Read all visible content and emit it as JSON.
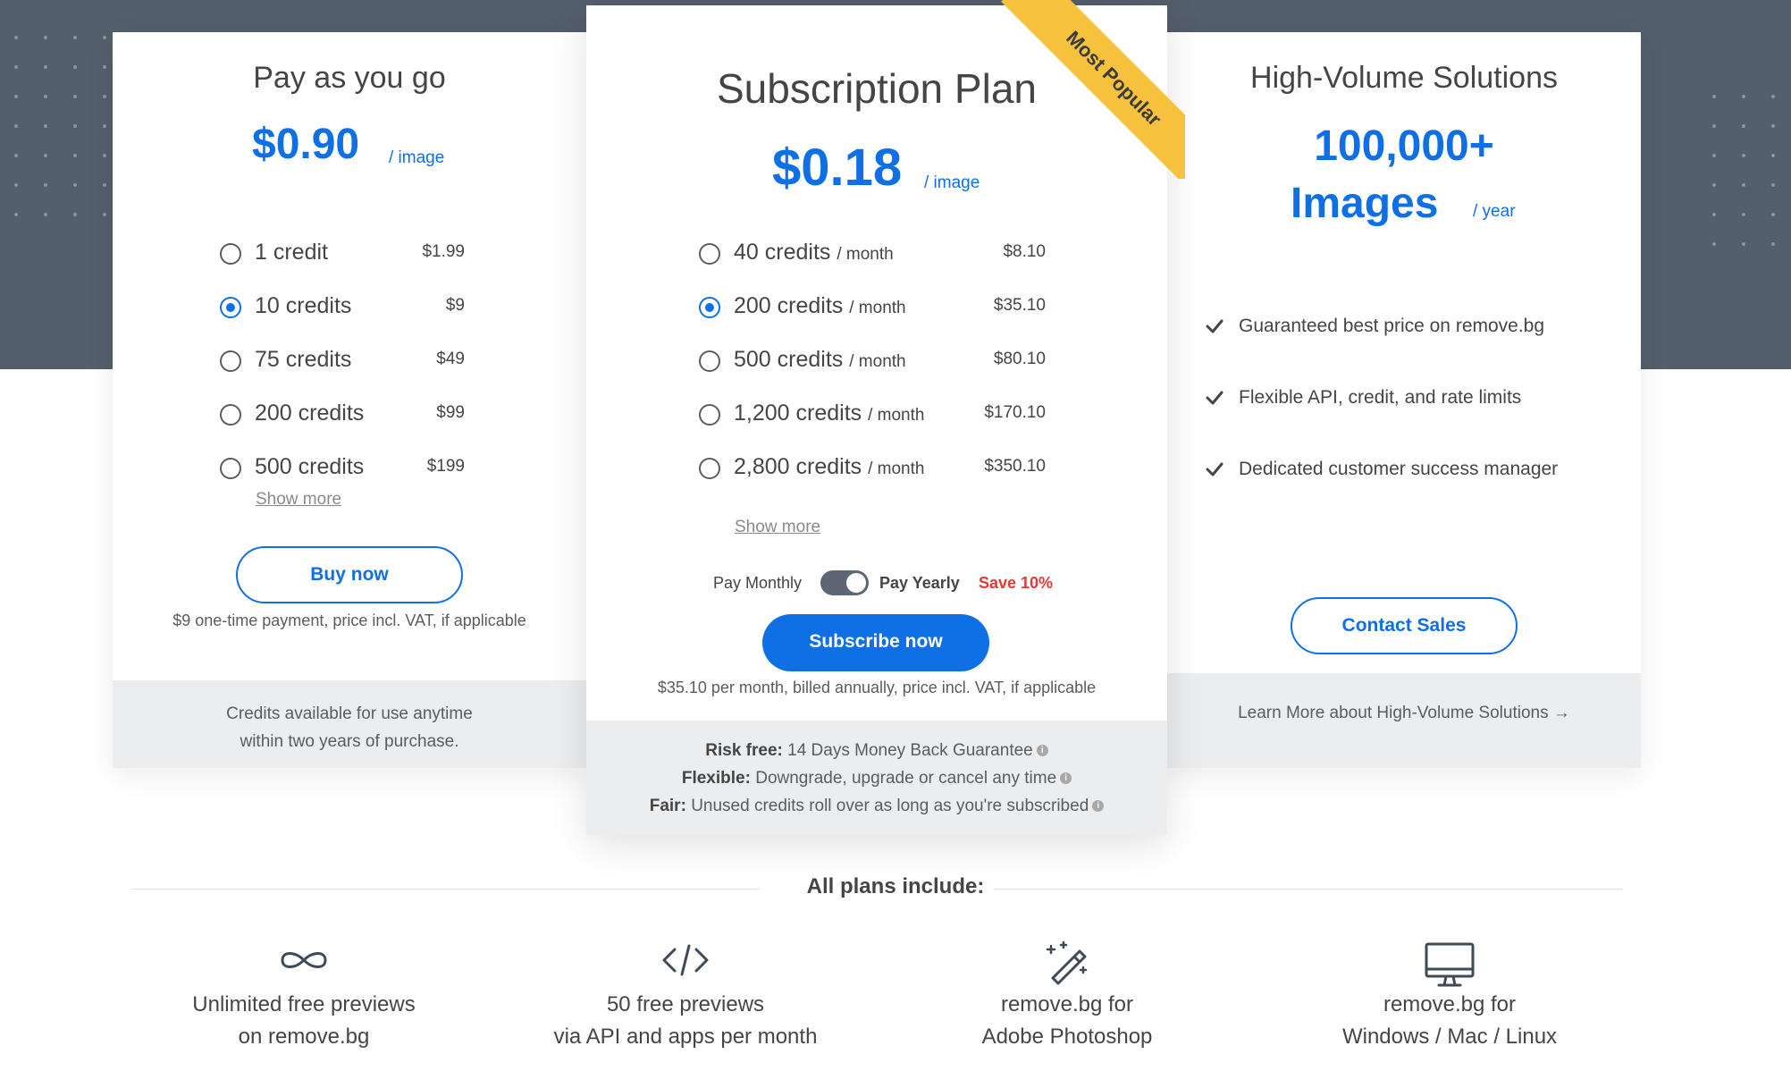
{
  "colors": {
    "accent": "#0f70e6",
    "hero": "#545f6c",
    "ribbon": "#f6c23e",
    "save": "#e53935",
    "footer": "#ebedef"
  },
  "payg": {
    "title": "Pay as you go",
    "price": "$0.90",
    "per": "/ image",
    "options": [
      {
        "label": "1 credit",
        "price": "$1.99",
        "selected": false
      },
      {
        "label": "10 credits",
        "price": "$9",
        "selected": true
      },
      {
        "label": "75 credits",
        "price": "$49",
        "selected": false
      },
      {
        "label": "200 credits",
        "price": "$99",
        "selected": false
      },
      {
        "label": "500 credits",
        "price": "$199",
        "selected": false
      }
    ],
    "show_more": "Show more",
    "button": "Buy now",
    "note": "$9 one-time payment, price incl. VAT, if applicable",
    "footer_line1": "Credits available for use anytime",
    "footer_line2": "within two years of purchase."
  },
  "subscription": {
    "ribbon": "Most Popular",
    "title": "Subscription Plan",
    "price": "$0.18",
    "per": "/ image",
    "options": [
      {
        "label": "40 credits",
        "unit": "/ month",
        "price": "$8.10",
        "selected": false
      },
      {
        "label": "200 credits",
        "unit": "/ month",
        "price": "$35.10",
        "selected": true
      },
      {
        "label": "500 credits",
        "unit": "/ month",
        "price": "$80.10",
        "selected": false
      },
      {
        "label": "1,200 credits",
        "unit": "/ month",
        "price": "$170.10",
        "selected": false
      },
      {
        "label": "2,800 credits",
        "unit": "/ month",
        "price": "$350.10",
        "selected": false
      }
    ],
    "show_more": "Show more",
    "pay_monthly": "Pay Monthly",
    "pay_yearly": "Pay Yearly",
    "save": "Save 10%",
    "toggle_yearly": true,
    "button": "Subscribe now",
    "note": "$35.10 per month, billed annually, price incl. VAT, if applicable",
    "guarantees": [
      {
        "bold": "Risk free:",
        "text": "14 Days Money Back Guarantee"
      },
      {
        "bold": "Flexible:",
        "text": "Downgrade, upgrade or cancel any time"
      },
      {
        "bold": "Fair:",
        "text": "Unused credits roll over as long as you're subscribed"
      }
    ],
    "info_glyph": "i"
  },
  "highvolume": {
    "title": "High-Volume Solutions",
    "amount_line1": "100,000+",
    "amount_line2": "Images",
    "per": "/ year",
    "features": [
      "Guaranteed best price on remove.bg",
      "Flexible API, credit, and rate limits",
      "Dedicated customer success manager"
    ],
    "button": "Contact Sales",
    "footer_link": "Learn More about High-Volume Solutions",
    "footer_arrow": "→"
  },
  "includes": {
    "title": "All plans include:",
    "items": [
      {
        "icon": "infinity-icon",
        "line1": "Unlimited free previews",
        "line2": "on remove.bg"
      },
      {
        "icon": "code-icon",
        "line1": "50 free previews",
        "line2": "via API and apps per month"
      },
      {
        "icon": "magic-wand-icon",
        "line1": "remove.bg for",
        "line2": "Adobe Photoshop"
      },
      {
        "icon": "desktop-icon",
        "line1": "remove.bg for",
        "line2": "Windows / Mac / Linux"
      }
    ]
  }
}
